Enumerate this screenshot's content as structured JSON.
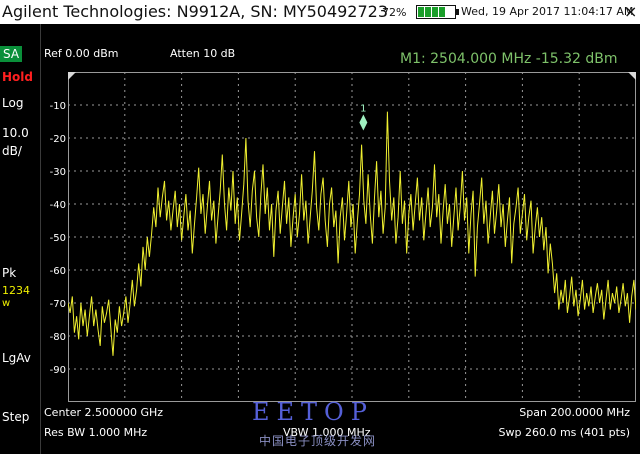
{
  "titlebar": {
    "title": "Agilent Technologies: N9912A, SN: MY50492723",
    "battery_percent": "72%",
    "battery_level": 0.72,
    "datetime": "Wed, 19 Apr 2017 11:04:17 AM",
    "close_glyph": "×"
  },
  "sidebar": {
    "mode": "SA",
    "hold": "Hold",
    "scale_type": "Log",
    "scale_value": "10.0",
    "scale_unit": "dB/",
    "detector": "Pk",
    "traces": "1234",
    "trace_state": "w",
    "average_type": "LgAv",
    "step": "Step"
  },
  "header": {
    "ref_level": "Ref 0.00 dBm",
    "attenuation": "Atten 10 dB",
    "marker_readout": "M1:  2504.000 MHz  -15.32 dBm"
  },
  "graticule": {
    "y_ticks": [
      "-10",
      "-20",
      "-30",
      "-40",
      "-50",
      "-60",
      "-70",
      "-80",
      "-90"
    ],
    "marker_label": "1",
    "colors": {
      "trace": "#f0f030",
      "grid": "#9a9a9a",
      "marker": "#9ff0c0"
    }
  },
  "chart_data": {
    "type": "line",
    "x_unit": "MHz",
    "y_unit": "dBm",
    "xlim": [
      2400,
      2600
    ],
    "ylim": [
      -100,
      0
    ],
    "marker": {
      "name": "1",
      "x": 2504.0,
      "y": -15.32
    },
    "series": [
      {
        "y": [
          -70,
          -73,
          -68,
          -79,
          -74,
          -81,
          -70,
          -77,
          -72,
          -80,
          -74,
          -68,
          -77,
          -72,
          -78,
          -83,
          -71,
          -76,
          -73,
          -69,
          -78,
          -86,
          -75,
          -79,
          -71,
          -77,
          -73,
          -68,
          -76,
          -70,
          -63,
          -71,
          -66,
          -58,
          -65,
          -53,
          -60,
          -50,
          -56,
          -49,
          -41,
          -47,
          -35,
          -44,
          -38,
          -33,
          -45,
          -39,
          -48,
          -42,
          -36,
          -47,
          -40,
          -51,
          -44,
          -37,
          -48,
          -42,
          -55,
          -46,
          -38,
          -29,
          -43,
          -37,
          -49,
          -41,
          -33,
          -45,
          -39,
          -52,
          -44,
          -36,
          -25,
          -40,
          -48,
          -35,
          -42,
          -30,
          -46,
          -38,
          -51,
          -43,
          -34,
          -20,
          -39,
          -47,
          -36,
          -30,
          -44,
          -50,
          -37,
          -28,
          -43,
          -35,
          -48,
          -40,
          -56,
          -42,
          -36,
          -49,
          -41,
          -33,
          -46,
          -38,
          -53,
          -44,
          -37,
          -50,
          -43,
          -31,
          -45,
          -39,
          -52,
          -44,
          -36,
          -24,
          -41,
          -48,
          -37,
          -32,
          -45,
          -53,
          -40,
          -35,
          -47,
          -42,
          -58,
          -44,
          -38,
          -51,
          -43,
          -33,
          -47,
          -40,
          -55,
          -45,
          -37,
          -22,
          -39,
          -46,
          -31,
          -43,
          -52,
          -38,
          -27,
          -44,
          -36,
          -49,
          -41,
          -12,
          -33,
          -45,
          -38,
          -52,
          -44,
          -30,
          -46,
          -39,
          -55,
          -43,
          -37,
          -48,
          -40,
          -32,
          -45,
          -38,
          -51,
          -43,
          -35,
          -47,
          -41,
          -28,
          -44,
          -37,
          -52,
          -42,
          -34,
          -46,
          -40,
          -53,
          -44,
          -35,
          -48,
          -41,
          -30,
          -45,
          -38,
          -55,
          -43,
          -36,
          -62,
          -47,
          -40,
          -32,
          -46,
          -39,
          -52,
          -44,
          -36,
          -49,
          -42,
          -34,
          -47,
          -40,
          -53,
          -45,
          -38,
          -58,
          -46,
          -41,
          -35,
          -49,
          -43,
          -37,
          -51,
          -44,
          -39,
          -55,
          -47,
          -41,
          -50,
          -44,
          -54,
          -47,
          -61,
          -52,
          -58,
          -67,
          -61,
          -72,
          -66,
          -70,
          -63,
          -73,
          -68,
          -62,
          -71,
          -66,
          -74,
          -69,
          -63,
          -72,
          -67,
          -71,
          -65,
          -73,
          -68,
          -64,
          -70,
          -66,
          -75,
          -69,
          -63,
          -72,
          -67,
          -70,
          -65,
          -73,
          -69,
          -64,
          -71,
          -67,
          -76,
          -68,
          -63,
          -72
        ]
      }
    ]
  },
  "footer": {
    "center": "Center 2.500000 GHz",
    "rbw": "Res BW 1.000 MHz",
    "vbw": "VBW 1.000 MHz",
    "span": "Span 200.0000 MHz",
    "sweep": "Swp 260.0 ms (401 pts)"
  },
  "watermark": {
    "main": "EETOP",
    "sub": "中国电子顶级开发网"
  }
}
